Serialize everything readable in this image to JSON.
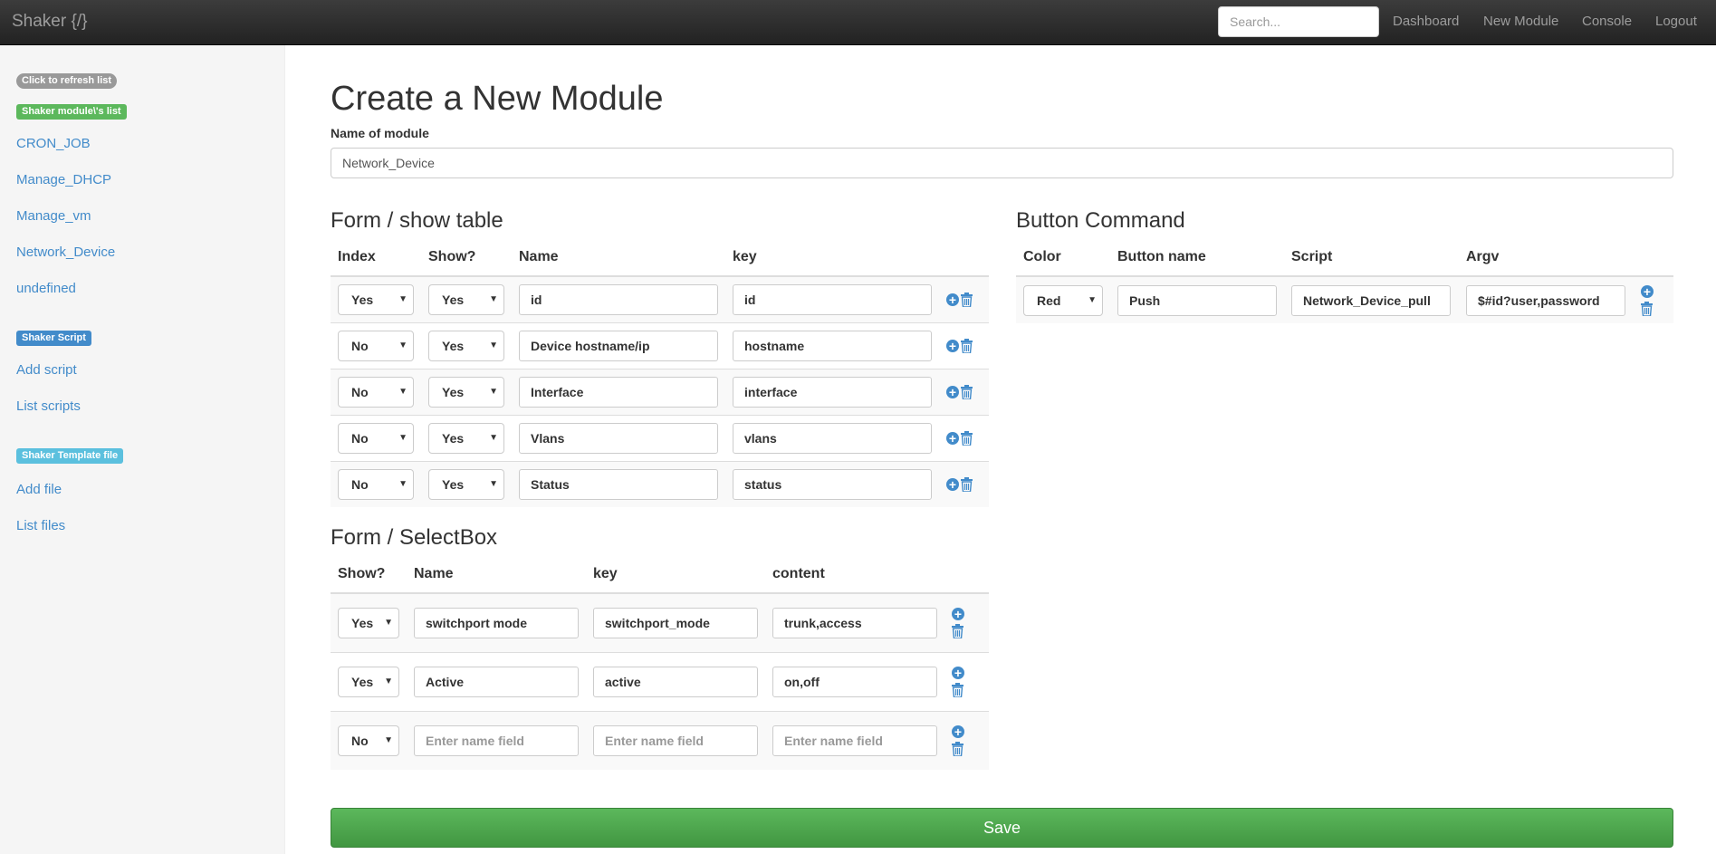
{
  "navbar": {
    "brand": "Shaker {/}",
    "search_placeholder": "Search...",
    "links": [
      "Dashboard",
      "New Module",
      "Console",
      "Logout"
    ]
  },
  "sidebar": {
    "refresh_label": "Click to refresh list",
    "modules_label": "Shaker module\\'s list",
    "modules": [
      "CRON_JOB",
      "Manage_DHCP",
      "Manage_vm",
      "Network_Device",
      "undefined"
    ],
    "script_label": "Shaker Script",
    "script_links": [
      "Add script",
      "List scripts"
    ],
    "template_label": "Shaker Template file",
    "template_links": [
      "Add file",
      "List files"
    ]
  },
  "main": {
    "title": "Create a New Module",
    "name_label": "Name of module",
    "name_value": "Network_Device",
    "show_table": {
      "title": "Form / show table",
      "headers": [
        "Index",
        "Show?",
        "Name",
        "key"
      ],
      "rows": [
        {
          "index": "Yes",
          "show": "Yes",
          "name": "id",
          "key": "id"
        },
        {
          "index": "No",
          "show": "Yes",
          "name": "Device hostname/ip",
          "key": "hostname"
        },
        {
          "index": "No",
          "show": "Yes",
          "name": "Interface",
          "key": "interface"
        },
        {
          "index": "No",
          "show": "Yes",
          "name": "Vlans",
          "key": "vlans"
        },
        {
          "index": "No",
          "show": "Yes",
          "name": "Status",
          "key": "status"
        }
      ]
    },
    "selectbox": {
      "title": "Form / SelectBox",
      "headers": [
        "Show?",
        "Name",
        "key",
        "content"
      ],
      "rows": [
        {
          "show": "Yes",
          "name": "switchport mode",
          "key": "switchport_mode",
          "content": "trunk,access"
        },
        {
          "show": "Yes",
          "name": "Active",
          "key": "active",
          "content": "on,off"
        },
        {
          "show": "No",
          "name": "",
          "key": "",
          "content": ""
        }
      ],
      "placeholder": "Enter name field"
    },
    "button_command": {
      "title": "Button Command",
      "headers": [
        "Color",
        "Button name",
        "Script",
        "Argv"
      ],
      "rows": [
        {
          "color": "Red",
          "button_name": "Push",
          "script": "Network_Device_pull",
          "argv": "$#id?user,password"
        }
      ]
    },
    "save_label": "Save"
  },
  "colors": {
    "navbar": "#222222",
    "link": "#428bca",
    "save": "#5cb85c"
  }
}
